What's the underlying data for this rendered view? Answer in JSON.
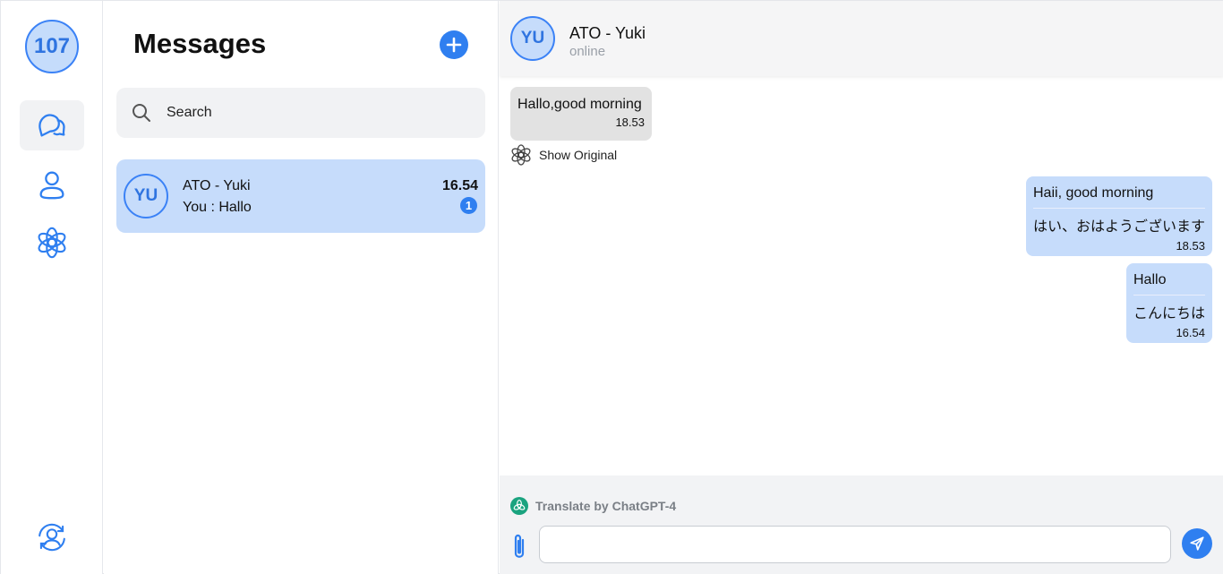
{
  "profile": {
    "avatar_text": "107"
  },
  "rail": {
    "items": [
      {
        "name": "chats",
        "icon": "chat-bubbles-icon",
        "active": true
      },
      {
        "name": "contacts",
        "icon": "user-icon",
        "active": false
      },
      {
        "name": "chatgpt",
        "icon": "openai-icon",
        "active": false
      }
    ],
    "bottom_icon": "account-switch-icon"
  },
  "list": {
    "title": "Messages",
    "search_placeholder": "Search",
    "conversations": [
      {
        "avatar": "YU",
        "name": "ATO - Yuki",
        "preview": "You : Hallo",
        "time": "16.54",
        "unread": "1"
      }
    ]
  },
  "chat": {
    "avatar": "YU",
    "name": "ATO - Yuki",
    "status": "online",
    "messages": [
      {
        "direction": "in",
        "text": "Hallo,good morning",
        "time": "18.53",
        "action": "Show Original"
      },
      {
        "direction": "out",
        "text": "Haii, good morning",
        "translation": "はい、おはようございます",
        "time": "18.53"
      },
      {
        "direction": "out",
        "text": "Hallo",
        "translation": "こんにちは",
        "time": "16.54"
      }
    ],
    "translate_label": "Translate by ChatGPT-4",
    "input_value": ""
  },
  "colors": {
    "accent": "#2f7ff0",
    "selected_bg": "#c6dcfb",
    "incoming_bg": "#e2e2e2",
    "gpt_green": "#1aa37f"
  }
}
